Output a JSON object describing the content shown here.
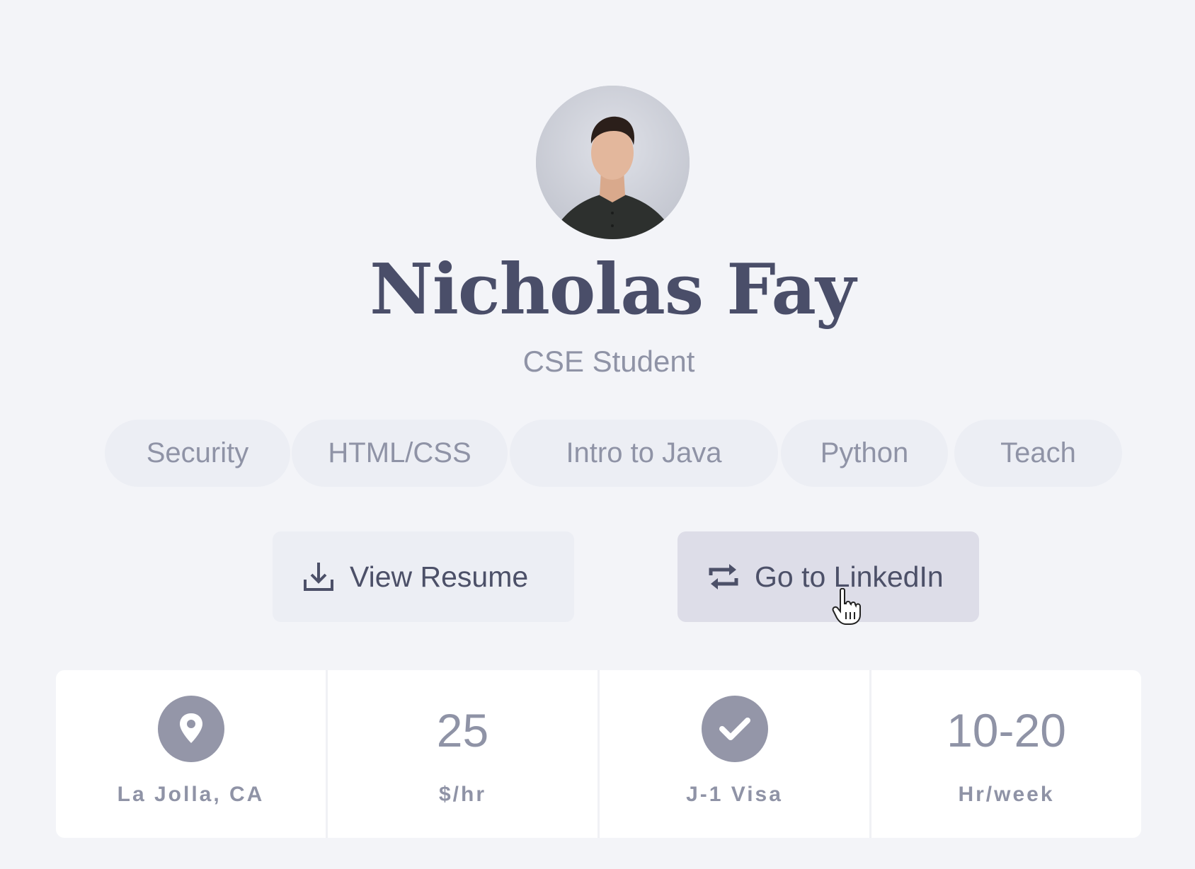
{
  "profile": {
    "name": "Nicholas Fay",
    "title": "CSE Student",
    "avatar_icon": "person-photo"
  },
  "tags": [
    "Security",
    "HTML/CSS",
    "Intro to Java",
    "Python",
    "Teach"
  ],
  "actions": {
    "resume": {
      "label": "View Resume",
      "icon": "download-icon"
    },
    "linkedin": {
      "label": "Go to LinkedIn",
      "icon": "repeat-icon"
    }
  },
  "stats": {
    "location": {
      "icon": "map-pin-icon",
      "label": "La Jolla, CA"
    },
    "rate": {
      "value": "25",
      "label": "$/hr"
    },
    "visa": {
      "icon": "check-icon",
      "label": "J-1 Visa"
    },
    "hours": {
      "value": "10-20",
      "label": "Hr/week"
    }
  },
  "colors": {
    "background": "#f3f4f8",
    "text_dark": "#4a4e69",
    "text_muted": "#8f93a6",
    "chip_bg": "#eceef4",
    "button_active_bg": "#dddde8",
    "icon_circle": "#9496a8"
  }
}
